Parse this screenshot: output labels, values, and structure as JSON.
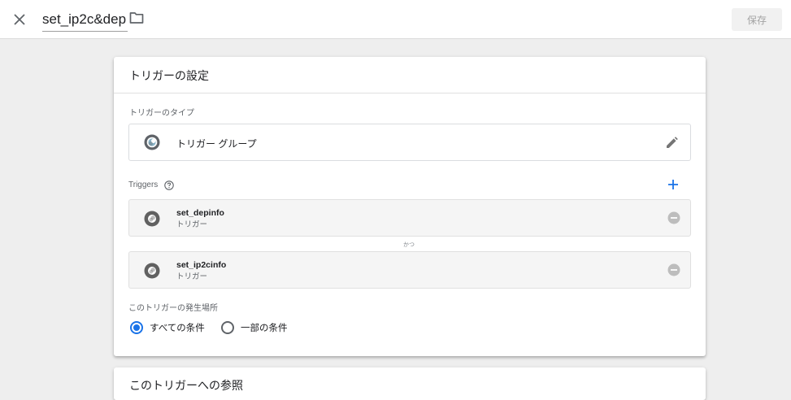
{
  "topbar": {
    "title": "set_ip2c&dep",
    "close_icon": "close-icon",
    "folder_icon": "folder-icon",
    "save_label": "保存"
  },
  "config_card": {
    "title": "トリガーの設定",
    "trigger_type_label": "トリガーのタイプ",
    "trigger_type_name": "トリガー グループ",
    "triggers_label": "Triggers",
    "triggers": [
      {
        "name": "set_depinfo",
        "type": "トリガー"
      },
      {
        "name": "set_ip2cinfo",
        "type": "トリガー"
      }
    ],
    "and_label": "かつ",
    "fire_on_label": "このトリガーの発生場所",
    "fire_options": [
      {
        "label": "すべての条件",
        "selected": true
      },
      {
        "label": "一部の条件",
        "selected": false
      }
    ]
  },
  "references_card": {
    "title": "このトリガーへの参照"
  },
  "colors": {
    "accent": "#1a73e8",
    "icon_gray": "#5f6368",
    "save_bg": "#f1f1f1"
  }
}
